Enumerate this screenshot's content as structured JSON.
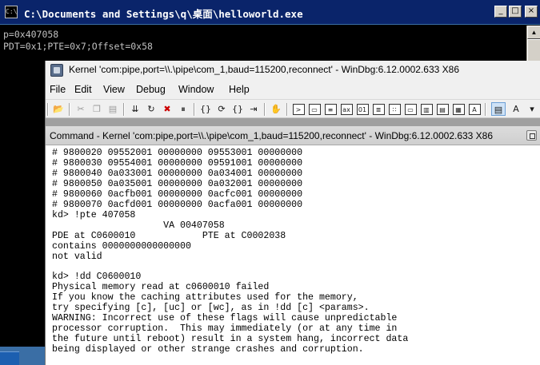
{
  "console": {
    "title": "C:\\Documents and Settings\\q\\桌面\\helloworld.exe",
    "icon_label": "C:\\",
    "lines": [
      "p=0x407058",
      "PDT=0x1;PTE=0x7;Offset=0x58"
    ]
  },
  "windbg": {
    "title": "Kernel 'com:pipe,port=\\\\.\\pipe\\com_1,baud=115200,reconnect' - WinDbg:6.12.0002.633 X86",
    "menu": [
      "File",
      "Edit",
      "View",
      "Debug",
      "Window",
      "Help"
    ],
    "toolbar_icons": [
      "open-icon",
      "cut-icon",
      "copy-icon",
      "paste-icon",
      "go-icon",
      "restart-icon",
      "stop-debugging-icon",
      "break-icon",
      "step-into-icon",
      "step-over-icon",
      "step-out-icon",
      "run-to-cursor-icon",
      "breakpoint-icon",
      "command-window-icon",
      "watch-window-icon",
      "locals-window-icon",
      "registers-window-icon",
      "memory-window-icon",
      "call-stack-icon",
      "disassembly-icon",
      "scratch-pad-icon",
      "source-mode-icon",
      "font-icon"
    ],
    "command_window": {
      "title": "Command - Kernel 'com:pipe,port=\\\\.\\pipe\\com_1,baud=115200,reconnect' - WinDbg:6.12.0002.633 X86",
      "output": [
        "# 9800020 09552001 00000000 09553001 00000000",
        "# 9800030 09554001 00000000 09591001 00000000",
        "# 9800040 0a033001 00000000 0a034001 00000000",
        "# 9800050 0a035001 00000000 0a032001 00000000",
        "# 9800060 0acfb001 00000000 0acfc001 00000000",
        "# 9800070 0acfd001 00000000 0acfa001 00000000",
        "kd> !pte 407058",
        "                    VA 00407058",
        "PDE at C0600010            PTE at C0002038",
        "contains 0000000000000000",
        "not valid",
        "",
        "kd> !dd C0600010",
        "Physical memory read at c0600010 failed",
        "If you know the caching attributes used for the memory,",
        "try specifying [c], [uc] or [wc], as in !dd [c] <params>.",
        "WARNING: Incorrect use of these flags will cause unpredictable",
        "processor corruption.  This may immediately (or at any time in",
        "the future until reboot) result in a system hang, incorrect data",
        "being displayed or other strange crashes and corruption."
      ]
    }
  }
}
